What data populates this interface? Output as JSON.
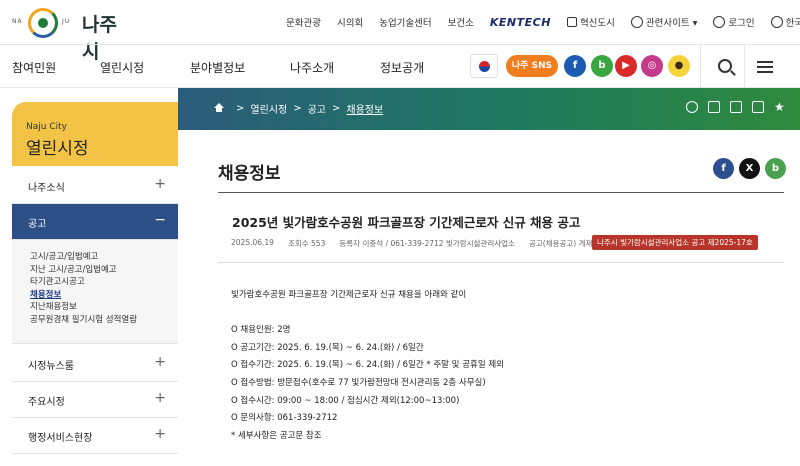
{
  "header": {
    "logo_small_left": "NA",
    "logo_small_right": "JU",
    "logo_text": "나주시",
    "links": [
      "문화관광",
      "시의회",
      "농업기술센터",
      "보건소"
    ],
    "kentech": "KENTECH",
    "innovation_city": "혁신도시",
    "related_sites": "관련사이트 ▾",
    "login": "로그인",
    "language": "한국어 ▾"
  },
  "nav": {
    "items": [
      "참여민원",
      "열린시정",
      "분야별정보",
      "나주소개",
      "정보공개"
    ],
    "sns_label": "나주 SNS"
  },
  "sns_icons": [
    "facebook-icon",
    "blog-icon",
    "youtube-icon",
    "instagram-icon",
    "kakao-icon"
  ],
  "breadcrumb": {
    "items": [
      "열린시정",
      "공고",
      "채용정보"
    ]
  },
  "sidebar": {
    "subtitle": "Naju City",
    "title": "열린시정",
    "items": [
      {
        "label": "나주소식",
        "sign": "+"
      },
      {
        "label": "공고",
        "sign": "−"
      },
      {
        "label": "시정뉴스룸",
        "sign": "+"
      },
      {
        "label": "주요시정",
        "sign": "+"
      },
      {
        "label": "행정서비스현장",
        "sign": "+"
      }
    ],
    "sub_items": [
      "고시/공고/입법예고",
      "지난 고시/공고/입법예고",
      "타기관고시공고",
      "채용정보",
      "지난채용정보",
      "공무원경채 필기시험 성적열람"
    ]
  },
  "content": {
    "page_title": "채용정보",
    "post_title": "2025년 빛가람호수공원 파크골프장 기간제근로자 신규 채용 공고",
    "meta": {
      "date": "2025.06.19",
      "views": "조회수 553",
      "author": "등록자 이충석 / 061-339-2712 빛가람시설관리사업소",
      "category": "공고(채용공고) 게재제호",
      "badge": "나주시 빛가람시설관리사업소 공고 제2025-17호"
    },
    "body": [
      "빛가람호수공원 파크골프장 기간제근로자 신규 채용을 아래와 같이",
      "",
      "O 채용인원: 2명",
      "O 공고기간: 2025. 6. 19.(목) ~ 6. 24.(화) / 6일간",
      "O 접수기간: 2025. 6. 19.(목) ~ 6. 24.(화) / 6일간 * 주말 및 공휴일 제외",
      "O 접수방법: 방문접수(호수로 77 빛가람전망대 전시관리동 2층 사무실)",
      "O 접수시간: 09:00 ~ 18:00 / 점심시간 제외(12:00~13:00)",
      "O 문의사항: 061-339-2712",
      "* 세부사항은 공고문 참조"
    ]
  },
  "colors": {
    "sidebar_head": "#f3c345",
    "sidebar_active": "#2c4f85",
    "badge": "#b7352a",
    "sns_orange": "#f07d1e"
  }
}
